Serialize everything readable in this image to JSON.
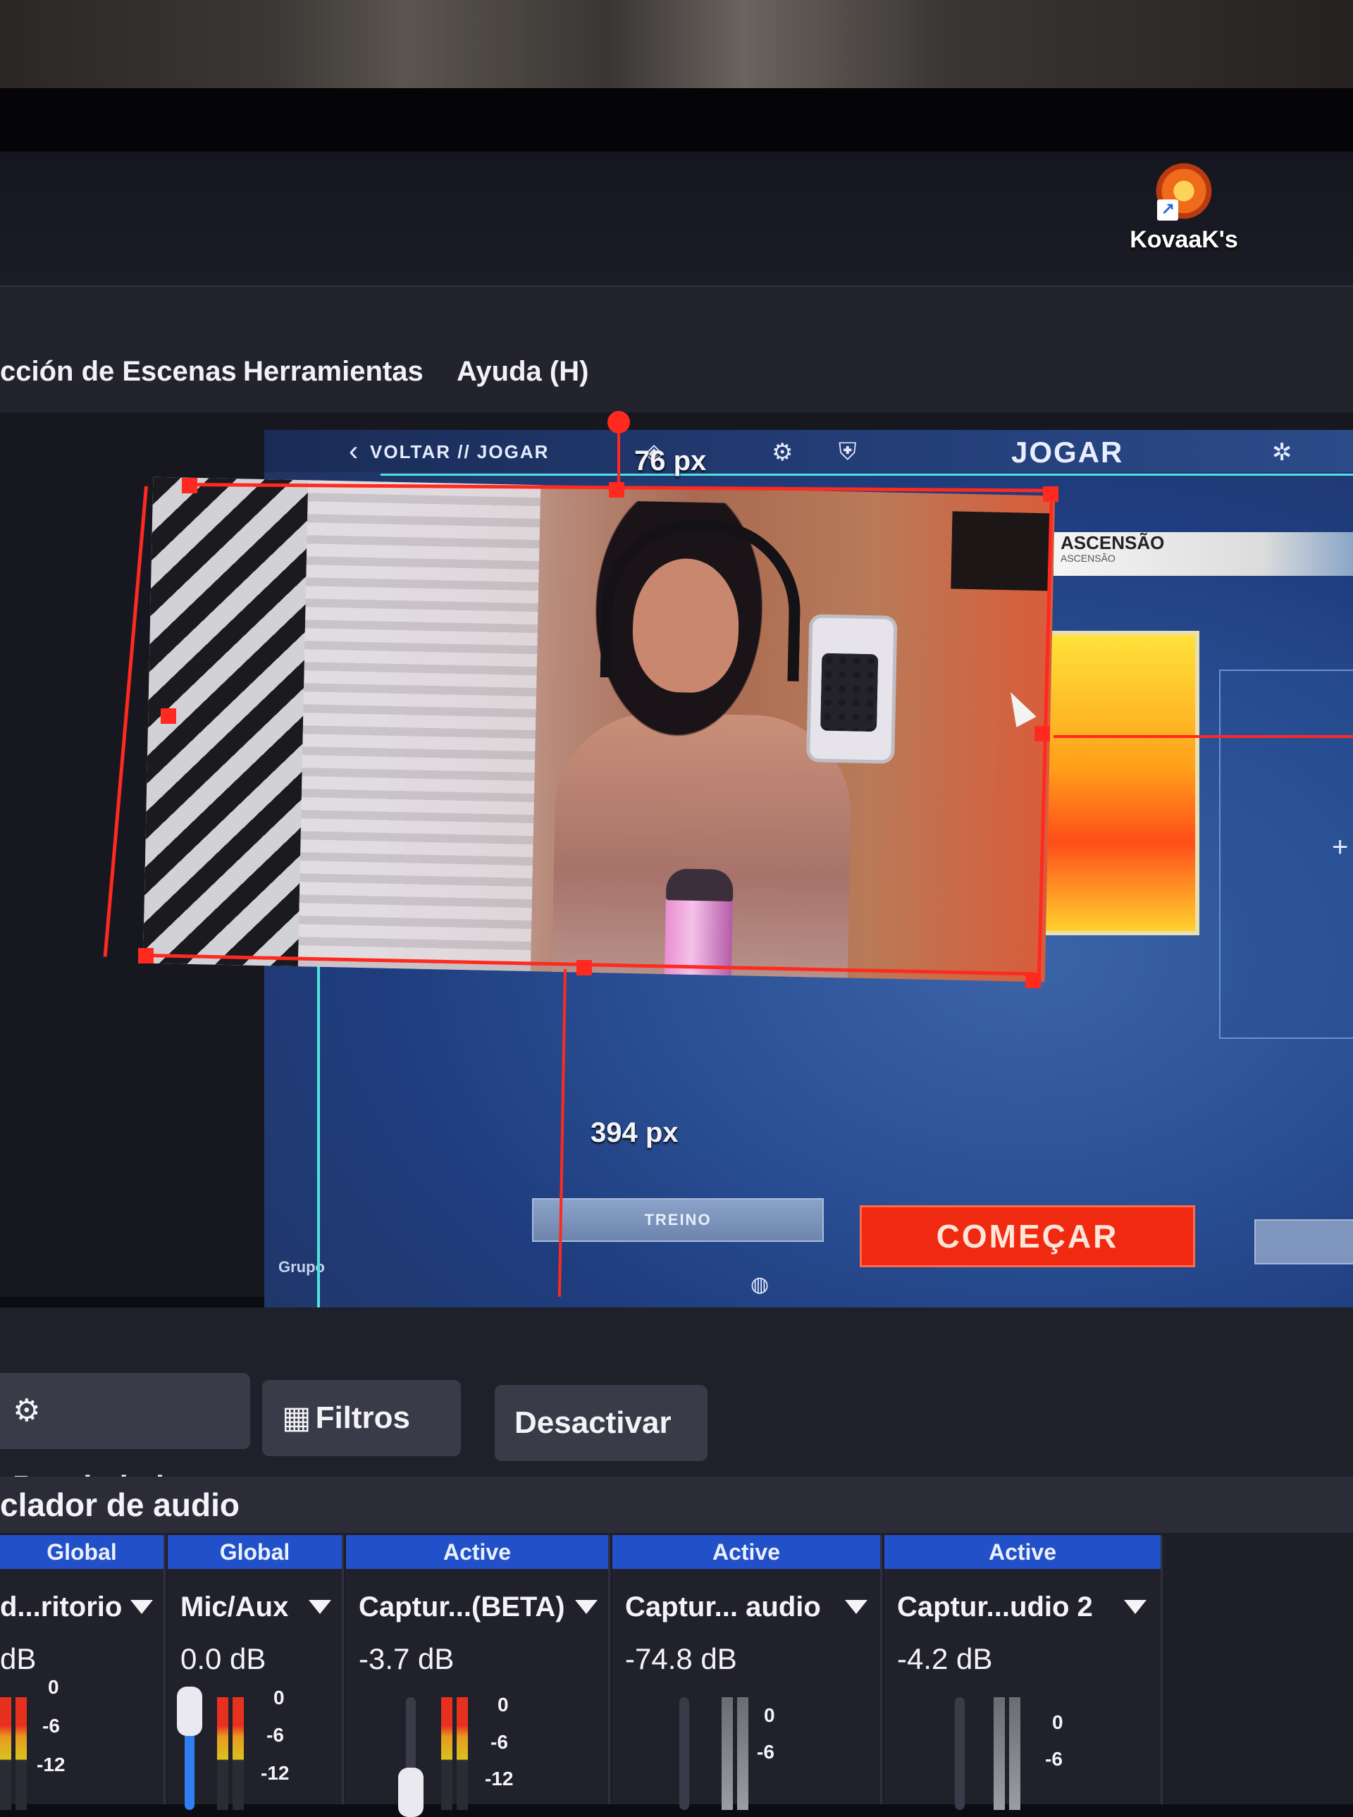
{
  "desktop": {
    "icon_label": "KovaaK's"
  },
  "menu": {
    "items": [
      "cción de Escenas",
      "Herramientas",
      "Ayuda (H)"
    ]
  },
  "game": {
    "back_label": "VOLTAR // JOGAR",
    "title": "JOGAR",
    "rank_banner": "ASCENSÃO",
    "rank_sub": "ASCENSÃO",
    "treino_label": "TREINO",
    "comecar_label": "COMEÇAR",
    "group_label": "Grupo"
  },
  "transform": {
    "top_offset_label": "76 px",
    "bottom_offset_label": "394 px"
  },
  "toolbar": {
    "properties_label": "Propiedades",
    "filters_label": "Filtros",
    "deactivate_label": "Desactivar"
  },
  "mixer": {
    "title": "clador de audio",
    "channels": [
      {
        "status": "Global",
        "name": "d...ritorio",
        "db": "dB"
      },
      {
        "status": "Global",
        "name": "Mic/Aux",
        "db": "0.0 dB"
      },
      {
        "status": "Active",
        "name": "Captur...(BETA)",
        "db": "-3.7 dB"
      },
      {
        "status": "Active",
        "name": "Captur... audio",
        "db": "-74.8 dB"
      },
      {
        "status": "Active",
        "name": "Captur...udio 2",
        "db": "-4.2 dB"
      }
    ],
    "ticks": [
      "0",
      "-6",
      "-12"
    ]
  },
  "colors": {
    "selection": "#ff2a1f",
    "guide": "#4fe3e0",
    "active_header": "#2250c8",
    "comecar": "#f02a10"
  }
}
